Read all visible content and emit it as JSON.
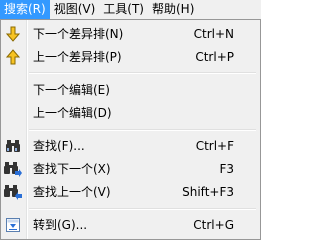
{
  "menubar": {
    "items": [
      {
        "label": "搜索(R)",
        "active": true
      },
      {
        "label": "视图(V)",
        "active": false
      },
      {
        "label": "工具(T)",
        "active": false
      },
      {
        "label": "帮助(H)",
        "active": false
      }
    ]
  },
  "menu": {
    "items": [
      {
        "label": "下一个差异排(N)",
        "shortcut": "Ctrl+N",
        "icon": "arrow-down-icon"
      },
      {
        "label": "上一个差异排(P)",
        "shortcut": "Ctrl+P",
        "icon": "arrow-up-icon"
      },
      {
        "label": "下一个编辑(E)",
        "shortcut": "",
        "icon": ""
      },
      {
        "label": "上一个编辑(D)",
        "shortcut": "",
        "icon": ""
      },
      {
        "label": "查找(F)...",
        "shortcut": "Ctrl+F",
        "icon": "binoculars-icon"
      },
      {
        "label": "查找下一个(X)",
        "shortcut": "F3",
        "icon": "binoculars-next-icon"
      },
      {
        "label": "查找上一个(V)",
        "shortcut": "Shift+F3",
        "icon": "binoculars-prev-icon"
      },
      {
        "label": "转到(G)...",
        "shortcut": "Ctrl+G",
        "icon": "goto-icon"
      }
    ]
  },
  "colors": {
    "menu_bg": "#f0f0f0",
    "highlight": "#3399ff",
    "arrow_fill": "#f7c323",
    "binocular": "#333333",
    "accent_blue": "#2a6fd6"
  }
}
